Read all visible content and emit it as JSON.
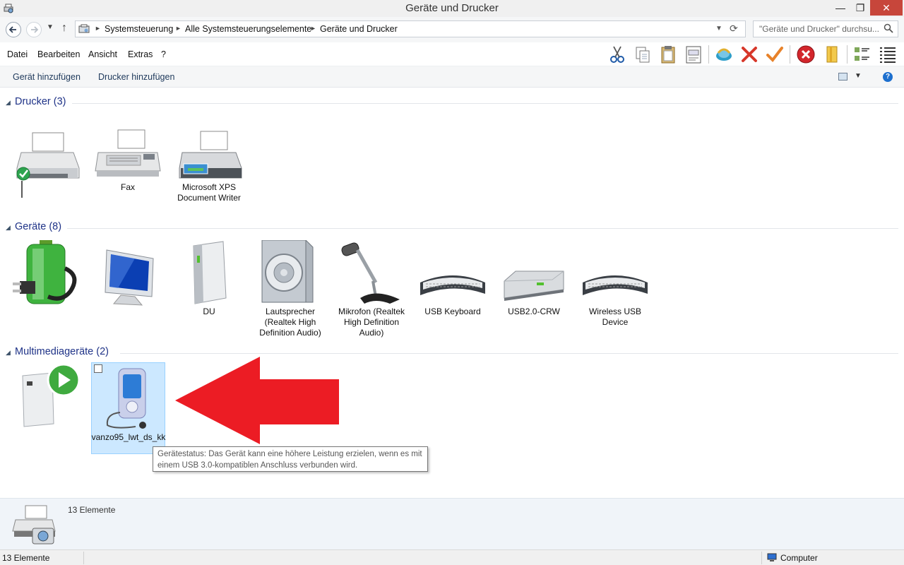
{
  "window": {
    "title": "Geräte und Drucker",
    "min_glyph": "—",
    "max_glyph": "❐",
    "close_glyph": "✕"
  },
  "address": {
    "breadcrumb": [
      "Systemsteuerung",
      "Alle Systemsteuerungselemente",
      "Geräte und Drucker"
    ],
    "search_placeholder": "\"Geräte und Drucker\" durchsu..."
  },
  "menu": [
    "Datei",
    "Bearbeiten",
    "Ansicht",
    "Extras",
    "?"
  ],
  "toolbar_icons": [
    "cut-icon",
    "copy-icon",
    "paste-icon",
    "properties-icon",
    "network-icon",
    "delete-icon",
    "check-icon",
    "stop-icon",
    "folder-icon",
    "details-view-icon",
    "list-view-icon"
  ],
  "commands": {
    "add_device": "Gerät hinzufügen",
    "add_printer": "Drucker hinzufügen"
  },
  "groups": {
    "printers": {
      "title": "Drucker (3)",
      "items": [
        {
          "label": "",
          "icon": "default-printer-icon"
        },
        {
          "label": "Fax",
          "icon": "fax-icon"
        },
        {
          "label": "Microsoft XPS Document Writer",
          "icon": "xps-printer-icon"
        }
      ]
    },
    "devices": {
      "title": "Geräte (8)",
      "items": [
        {
          "label": "",
          "icon": "battery-plug-icon"
        },
        {
          "label": "",
          "icon": "monitor-icon"
        },
        {
          "label": "DU",
          "icon": "drive-tower-icon"
        },
        {
          "label": "Lautsprecher (Realtek High Definition Audio)",
          "icon": "speaker-icon"
        },
        {
          "label": "Mikrofon (Realtek High Definition Audio)",
          "icon": "microphone-icon"
        },
        {
          "label": "USB Keyboard",
          "icon": "keyboard-icon"
        },
        {
          "label": "USB2.0-CRW",
          "icon": "card-reader-icon"
        },
        {
          "label": "Wireless USB Device",
          "icon": "keyboard-icon"
        }
      ]
    },
    "multimedia": {
      "title": "Multimediageräte (2)",
      "items": [
        {
          "label": "",
          "icon": "media-server-icon"
        },
        {
          "label": "vanzo95_lwt_ds_kk",
          "icon": "media-player-icon"
        }
      ]
    }
  },
  "tooltip": "Gerätestatus: Das Gerät kann eine höhere Leistung erzielen, wenn es mit einem USB 3.0-kompatiblen Anschluss verbunden wird.",
  "details": {
    "count": "13 Elemente"
  },
  "status": {
    "left": "13 Elemente",
    "right": "Computer"
  },
  "colors": {
    "arrow": "#ec1c24",
    "group_title": "#1e3287",
    "selection": "#cce8ff"
  }
}
